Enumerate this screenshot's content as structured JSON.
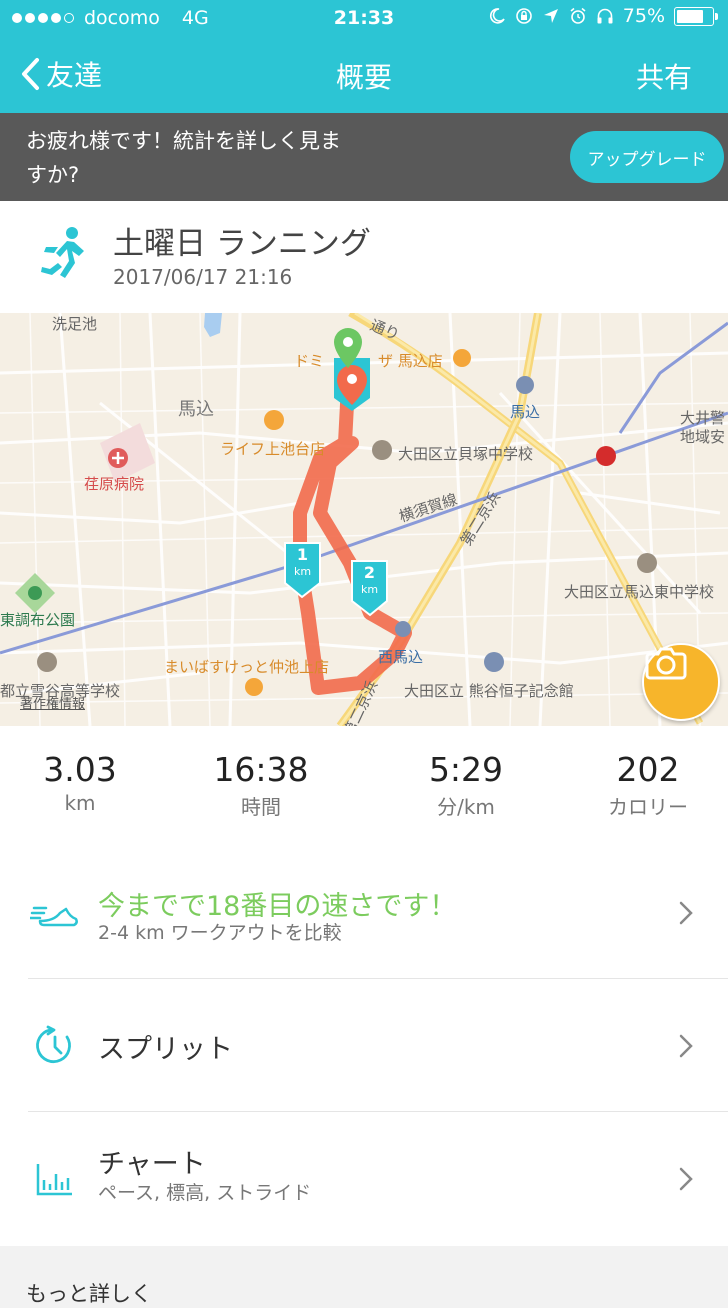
{
  "status_bar": {
    "carrier": "docomo",
    "network": "4G",
    "time": "21:33",
    "battery": "75%",
    "battery_level": 0.75
  },
  "nav": {
    "back_label": "友達",
    "title": "概要",
    "share_label": "共有"
  },
  "banner": {
    "message": "お疲れ様です！統計を詳しく見ますか?",
    "button_label": "アップグレード"
  },
  "activity": {
    "title": "土曜日 ランニング",
    "datetime": "2017/06/17 21:16"
  },
  "map": {
    "labels": {
      "senzokuike": "洗足池",
      "magome": "馬込",
      "ebara_hospital": "荏原病院",
      "life": "ライフ上池台店",
      "school_kaizuka": "大田区立貝塚中学校",
      "yokosuka_line": "横須賀線",
      "daini_keihin_a": "第二京浜",
      "magome_station": "馬込",
      "ooi_police_a": "大井警",
      "ooi_police_b": "地域安",
      "park": "東調布公園",
      "school_higashi": "大田区立馬込東中学校",
      "maibasket": "まいばすけっと仲池上店",
      "nishi_magome": "西馬込",
      "hs_yukigaya": "都立雪谷高等学校",
      "kumagai": "大田区立 熊谷恒子記念館",
      "daini_keihin_b": "第二京浜",
      "copyright": "著作権情報",
      "domino": "ドミ",
      "pizza": "ザ 馬込店",
      "dori": "通り"
    },
    "km_markers": [
      {
        "number": "1",
        "unit": "km"
      },
      {
        "number": "2",
        "unit": "km"
      }
    ],
    "colors": {
      "route": "#f26a4b",
      "start_pin": "#6cc763",
      "end_pin": "#f26a4b",
      "marker": "#2cc5d4"
    }
  },
  "stats": [
    {
      "value": "3.03",
      "unit": "km"
    },
    {
      "value": "16:38",
      "unit": "時間"
    },
    {
      "value": "5:29",
      "unit": "分/km"
    },
    {
      "value": "202",
      "unit": "カロリー"
    }
  ],
  "list": {
    "compare": {
      "title": "今までで18番目の速さです！",
      "subtitle": "2-4 km ワークアウトを比較",
      "title_color": "#7ccc5e"
    },
    "splits": {
      "title": "スプリット"
    },
    "chart": {
      "title": "チャート",
      "subtitle": "ペース, 標高, ストライド"
    }
  },
  "more": {
    "label": "もっと詳しく"
  },
  "theme": {
    "accent": "#2cc5d4",
    "banner_bg": "#595959"
  }
}
